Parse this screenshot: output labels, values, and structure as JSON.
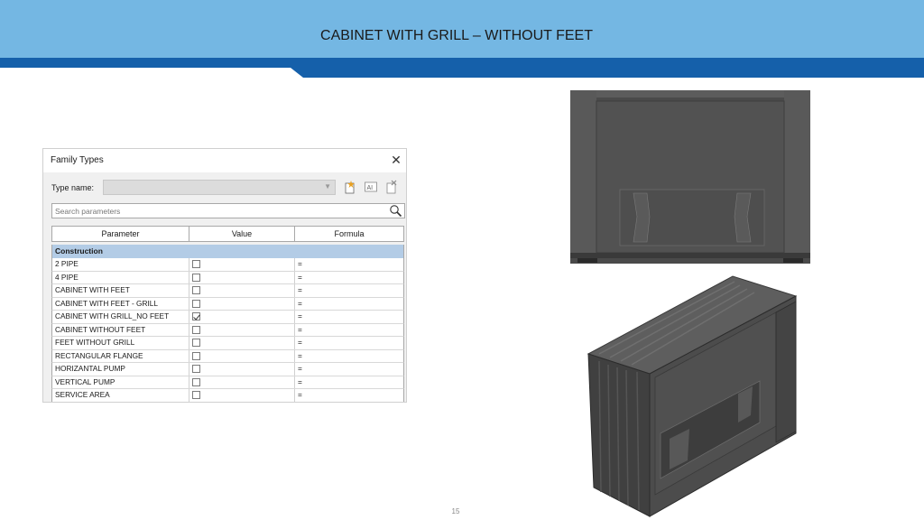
{
  "slide": {
    "title": "CABINET WITH GRILL – WITHOUT FEET",
    "page_number": "15",
    "colors": {
      "header_light": "#74b7e3",
      "header_dark": "#1560aa"
    }
  },
  "dialog": {
    "title": "Family Types",
    "close_icon": "close-icon",
    "type_name_label": "Type name:",
    "type_name_value": "",
    "toolbar_icons": [
      "new-type-icon",
      "rename-type-icon",
      "delete-type-icon"
    ],
    "search_placeholder": "Search parameters",
    "columns": [
      "Parameter",
      "Value",
      "Formula"
    ],
    "group": "Construction",
    "rows": [
      {
        "parameter": "2 PIPE",
        "checked": false,
        "formula": "="
      },
      {
        "parameter": "4 PIPE",
        "checked": false,
        "formula": "="
      },
      {
        "parameter": "CABINET WITH FEET",
        "checked": false,
        "formula": "="
      },
      {
        "parameter": "CABINET WITH FEET - GRILL",
        "checked": false,
        "formula": "="
      },
      {
        "parameter": "CABINET WITH GRILL_NO FEET",
        "checked": true,
        "formula": "="
      },
      {
        "parameter": "CABINET WITHOUT FEET",
        "checked": false,
        "formula": "="
      },
      {
        "parameter": "FEET WITHOUT GRILL",
        "checked": false,
        "formula": "="
      },
      {
        "parameter": "RECTANGULAR FLANGE",
        "checked": false,
        "formula": "="
      },
      {
        "parameter": "HORIZANTAL PUMP",
        "checked": false,
        "formula": "="
      },
      {
        "parameter": "VERTICAL PUMP",
        "checked": false,
        "formula": "="
      },
      {
        "parameter": "SERVICE AREA",
        "checked": false,
        "formula": "="
      }
    ]
  }
}
